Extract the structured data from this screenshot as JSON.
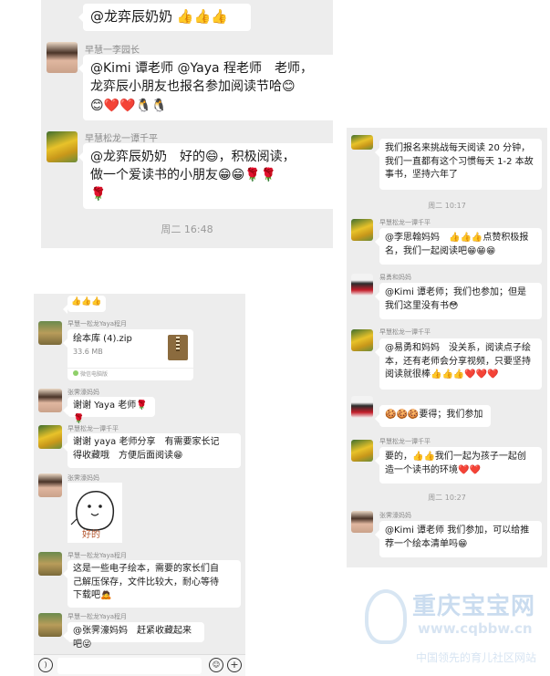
{
  "panel1": {
    "top_message": {
      "text": "@龙弈辰奶奶 👍👍👍"
    },
    "messages": [
      {
        "sender": "早慧一李园长",
        "lines": [
          "@Kimi 谭老师 @Yaya 程老师　老师，",
          "龙弈辰小朋友也报名参加阅读节哈😊",
          "😊❤️❤️🐧🐧"
        ]
      },
      {
        "sender": "早慧松龙一谭千平",
        "lines": [
          "@龙弈辰奶奶　好的😄，积极阅读，",
          "做一个爱读书的小朋友😁😁🌹🌹",
          "🌹"
        ]
      }
    ],
    "timestamp": "周二 16:48"
  },
  "panel2": {
    "messages": [
      {
        "sender": "",
        "lines": [
          "我们报名来挑战每天阅读 20 分钟，",
          "我们一直都有这个习惯每天 1-2 本故",
          "事书，坚持六年了"
        ]
      },
      {
        "type": "time",
        "text": "周二 10:17"
      },
      {
        "sender": "早慧松龙一谭千平",
        "lines": [
          "@李思翰妈妈　👍👍👍点赞积极报",
          "名，我们一起阅读吧😁😁😁"
        ]
      },
      {
        "sender": "易勇和妈妈",
        "lines": [
          "@Kimi 谭老师；我们也参加；但是",
          "我们这里没有书😳"
        ]
      },
      {
        "sender": "早慧松龙一谭千平",
        "lines": [
          "@易勇和妈妈　没关系，阅读点子绘",
          "本，还有老师会分享视频，只要坚持",
          "阅读就很棒👍👍👍❤️❤️❤️"
        ]
      },
      {
        "sender": "",
        "lines": [
          "🍪🍪🍪要得；我们参加"
        ]
      },
      {
        "sender": "早慧松龙一谭千平",
        "lines": [
          "要的，👍👍我们一起为孩子一起创",
          "造一个读书的环境❤️❤️"
        ]
      },
      {
        "type": "time",
        "text": "周二 10:27"
      },
      {
        "sender": "张霁濠妈妈",
        "lines": [
          "@Kimi 谭老师 我们参加，可以给推",
          "荐一个绘本清单吗😁"
        ]
      }
    ]
  },
  "panel3": {
    "top_message": {
      "text": "👍👍👍"
    },
    "file_message": {
      "sender": "早慧一松龙Yaya程月",
      "file_name": "绘本库 (4).zip",
      "file_size": "33.6 MB",
      "source": "微信电脑版"
    },
    "messages": [
      {
        "sender": "张霁濠妈妈",
        "lines": [
          "谢谢 Yaya 老师🌹🌹"
        ]
      },
      {
        "sender": "早慧松龙一谭千平",
        "lines": [
          "谢谢 yaya 老师分享　有需要家长记",
          "得收藏哦　方便后面阅读😁"
        ]
      },
      {
        "sender": "张霁濠妈妈",
        "sticker_text": "好的"
      },
      {
        "sender": "早慧一松龙Yaya程月",
        "lines": [
          "这是一些电子绘本，需要的家长们自",
          "己解压保存，文件比较大，耐心等待",
          "下载吧🙇"
        ]
      },
      {
        "sender": "早慧一松龙Yaya程月",
        "lines": [
          "@张霁濠妈妈　赶紧收藏起来吧😜"
        ]
      }
    ],
    "toolbar": {
      "voice_icon": "voice-icon",
      "emoji_icon": "emoji-icon",
      "add_icon": "add-icon"
    }
  },
  "watermark": {
    "brand": "重庆宝宝网",
    "url": "www.cqbbw.cn",
    "slogan": "中国领先的育儿社区网站"
  }
}
